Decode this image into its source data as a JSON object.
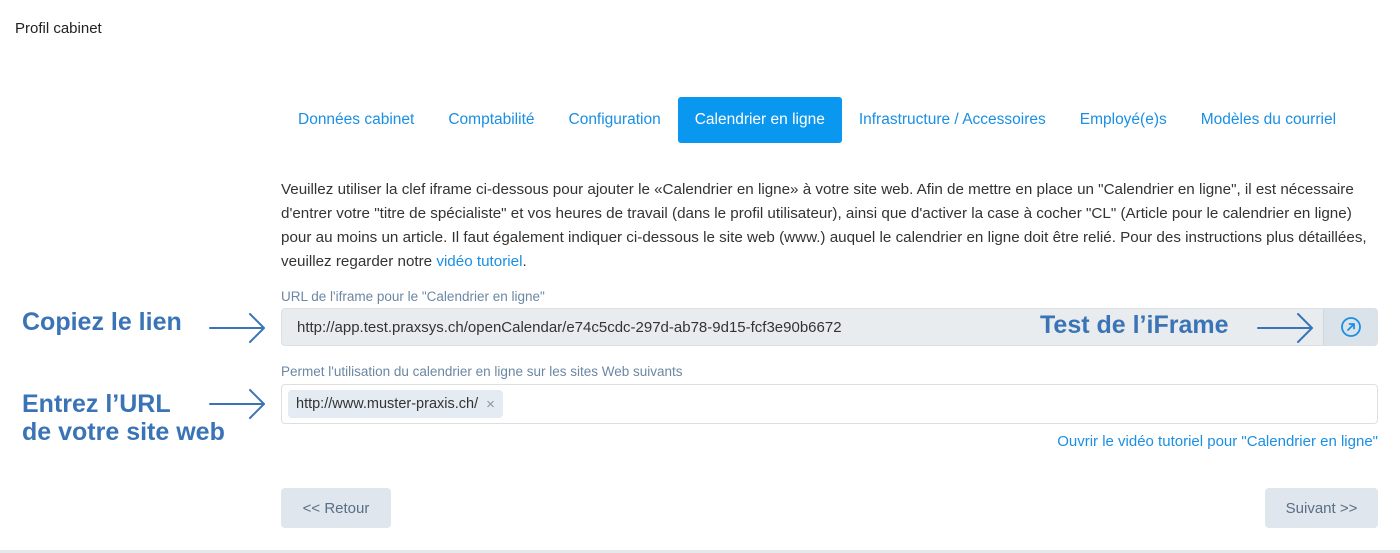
{
  "page": {
    "title": "Profil cabinet"
  },
  "tabs": [
    {
      "label": "Données cabinet",
      "active": false
    },
    {
      "label": "Comptabilité",
      "active": false
    },
    {
      "label": "Configuration",
      "active": false
    },
    {
      "label": "Calendrier en ligne",
      "active": true
    },
    {
      "label": "Infrastructure / Accessoires",
      "active": false
    },
    {
      "label": "Employé(e)s",
      "active": false
    },
    {
      "label": "Modèles du courriel",
      "active": false
    }
  ],
  "intro": {
    "text": "Veuillez utiliser la clef iframe ci-dessous pour ajouter le «Calendrier en ligne» à votre site web. Afin de mettre en place un \"Calendrier en ligne\", il est nécessaire d'entrer votre \"titre de spécialiste\" et vos heures de travail (dans le profil utilisateur), ainsi que d'activer la case à cocher \"CL\" (Article pour le calendrier en ligne) pour au moins un article. Il faut également indiquer ci-dessous le site web (www.) auquel le calendrier en ligne doit être relié. Pour des instructions plus détaillées, veuillez regarder notre ",
    "link": "vidéo tutoriel",
    "end": "."
  },
  "iframe_field": {
    "label": "URL de l'iframe pour le \"Calendrier en ligne\"",
    "value": "http://app.test.praxsys.ch/openCalendar/e74c5cdc-297d-ab78-9d15-fcf3e90b6672"
  },
  "sites_field": {
    "label": "Permet l'utilisation du calendrier en ligne sur les sites Web suivants",
    "chips": [
      "http://www.muster-praxis.ch/"
    ],
    "remove_glyph": "×"
  },
  "video_link": "Ouvrir le vidéo tutoriel pour \"Calendrier en ligne\"",
  "buttons": {
    "back": "<< Retour",
    "next": "Suivant >>"
  },
  "annotations": {
    "copy_link": "Copiez le lien",
    "enter_url_line1": "Entrez l’URL",
    "enter_url_line2": "de votre site web",
    "test_iframe": "Test de l’iFrame"
  },
  "colors": {
    "accent": "#0a97f0",
    "link": "#1a8fe3",
    "annotation": "#3a74b6"
  },
  "icons": {
    "test_button": "external-link-circle-icon",
    "annotation_arrow": "arrow-right-icon"
  }
}
